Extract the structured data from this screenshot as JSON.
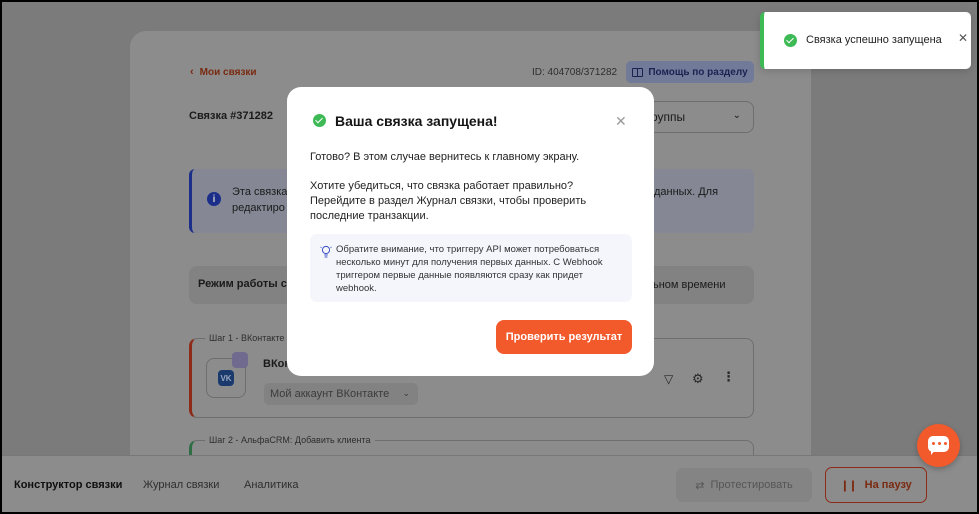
{
  "page": {
    "back_link": "Мои связки",
    "id_text": "ID: 404708/371282",
    "help_button": "Помощь по разделу",
    "link_title": "Связка #371282",
    "group_select": "руппы",
    "info_text_left": "Эта связка редактиро",
    "info_text_right": "данных. Для",
    "mode_label": "Режим работы св",
    "mode_value": "ьном времени",
    "step1_label": "Шаг 1 - ВКонтакте",
    "step1_name": "ВКонт",
    "step1_account": "Мой аккаунт ВКонтакте",
    "vk_logo": "VK",
    "step2_label": "Шаг 2 - АльфаCRM: Добавить клиента"
  },
  "bottom": {
    "tabs": [
      "Конструктор связки",
      "Журнал связки",
      "Аналитика"
    ],
    "test_button": "Протестировать",
    "pause_button": "На паузу"
  },
  "toast": {
    "text": "Связка успешно запущена"
  },
  "modal": {
    "title": "Ваша связка запущена!",
    "p1": "Готово? В этом случае вернитесь к главному экрану.",
    "p2": "Хотите убедиться, что связка работает правильно? Перейдите в раздел Журнал связки, чтобы проверить последние транзакции.",
    "note": "Обратите внимание, что триггеру API может потребоваться несколько минут для получения первых данных. С Webhook триггером первые данные появляются сразу как придет webhook.",
    "button": "Проверить результат"
  },
  "colors": {
    "accent": "#f25a2c",
    "success": "#3dba55"
  },
  "icons": {
    "back": "chevron-left-icon",
    "help": "book-icon",
    "info": "info-icon",
    "filter": "filter-icon",
    "settings": "gear-icon",
    "more": "more-vertical-icon",
    "test": "swap-icon",
    "pause": "pause-icon",
    "chat": "chat-icon",
    "success": "check-circle-icon",
    "close": "close-icon",
    "tip": "lightbulb-icon"
  }
}
